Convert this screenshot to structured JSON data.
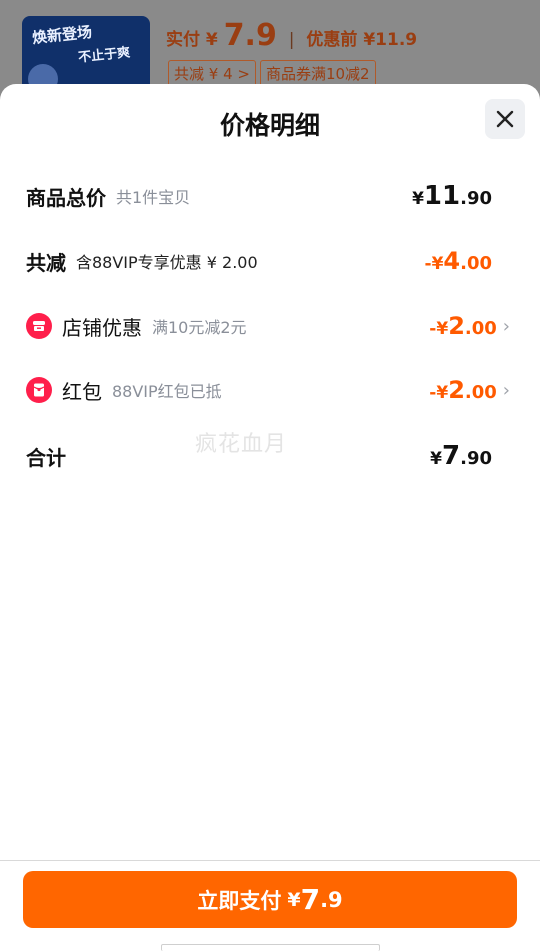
{
  "background_order": {
    "thumb_text1": "焕新登场",
    "thumb_text2": "不止于爽",
    "paid_label": "实付",
    "paid_currency": "¥",
    "paid_value": "7.9",
    "before_label": "优惠前",
    "before_value": "¥11.9",
    "tag_discount": "共减 ¥ 4 >",
    "tag_coupon": "商品券满10减2"
  },
  "sheet": {
    "title": "价格明细",
    "watermark": "疯花血月"
  },
  "rows": {
    "total": {
      "label": "商品总价",
      "sub": "共1件宝贝",
      "currency": "¥",
      "int": "11",
      "dec": ".90"
    },
    "reduction": {
      "label": "共减",
      "sub": "含88VIP专享优惠 ¥ 2.00",
      "prefix": "-",
      "currency": "¥",
      "int": "4",
      "dec": ".00"
    },
    "shop": {
      "label": "店铺优惠",
      "sub": "满10元减2元",
      "prefix": "-",
      "currency": "¥",
      "int": "2",
      "dec": ".00",
      "icon": "shop-icon"
    },
    "redpacket": {
      "label": "红包",
      "sub": "88VIP红包已抵",
      "prefix": "-",
      "currency": "¥",
      "int": "2",
      "dec": ".00",
      "icon": "red-packet-icon"
    },
    "sum": {
      "label": "合计",
      "currency": "¥",
      "int": "7",
      "dec": ".90"
    }
  },
  "pay_button": {
    "label": "立即支付",
    "currency": "¥",
    "int": "7",
    "dec": ".9"
  },
  "colors": {
    "accent": "#ff6600",
    "discount": "#ff5a00",
    "badge": "#ff1f4b"
  }
}
